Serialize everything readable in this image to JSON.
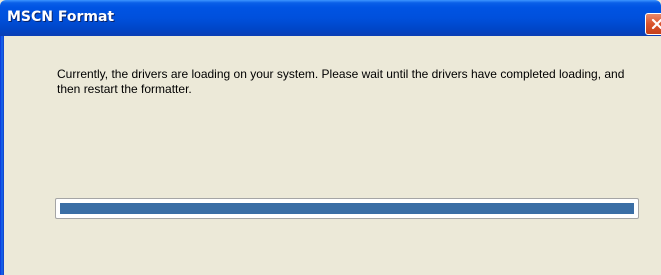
{
  "window": {
    "title": "MSCN Format",
    "close_icon": "close-icon"
  },
  "dialog": {
    "message": "Currently, the drivers are loading on your system. Please wait until the drivers have completed loading, and then restart the formatter."
  },
  "progress": {
    "value_fraction": 1.0,
    "fill_color": "#3a6ea5"
  },
  "colors": {
    "titlebar": "#0054e3",
    "background": "#ece9d8",
    "close_button": "#d9542c"
  }
}
